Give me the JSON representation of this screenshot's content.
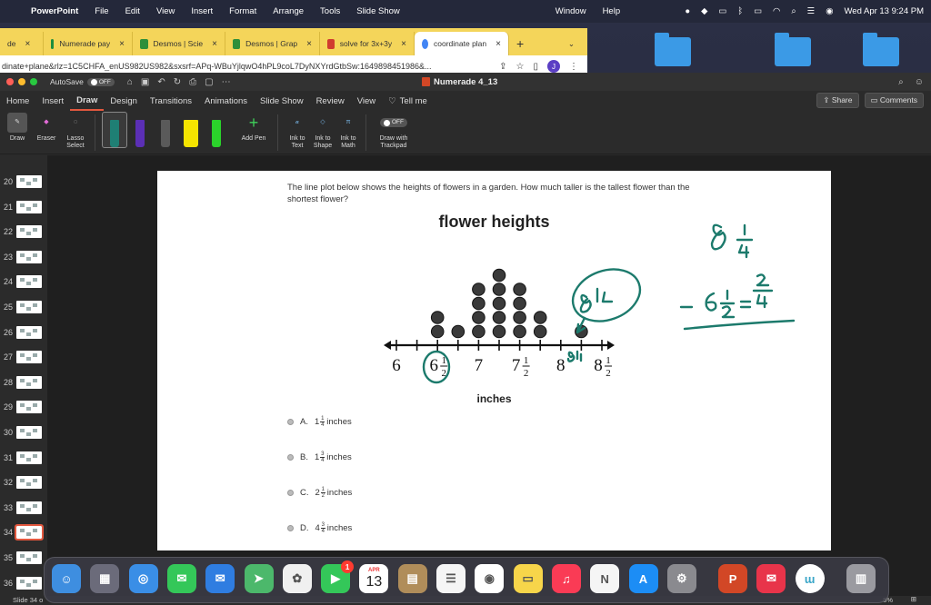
{
  "menubar": {
    "app": "PowerPoint",
    "menus": [
      "File",
      "Edit",
      "View",
      "Insert",
      "Format",
      "Arrange",
      "Tools",
      "Slide Show"
    ],
    "right_menus": [
      "Window",
      "Help"
    ],
    "clock": "Wed Apr 13  9:24 PM"
  },
  "browser": {
    "tabs": [
      {
        "label": "de",
        "color": "#f4d55a"
      },
      {
        "label": "Numerade pay",
        "color": "#1e8e3e"
      },
      {
        "label": "Desmos | Scie",
        "color": "#2f8f3a"
      },
      {
        "label": "Desmos | Grap",
        "color": "#2f8f3a"
      },
      {
        "label": "solve for 3x+3y",
        "color": "#d03c2f"
      },
      {
        "label": "coordinate plan",
        "color": "#4285f4"
      }
    ],
    "new_tab": "+",
    "url": "dinate+plane&rlz=1C5CHFA_enUS982US982&sxsrf=APq-WBuYjlqwO4hPL9coL7DyNXYrdGtbSw:1649898451986&...",
    "avatar": "J"
  },
  "ppt": {
    "autosave_label": "AutoSave",
    "autosave_state": "OFF",
    "doc_title": "Numerade 4_13",
    "ribbon_tabs": [
      "Home",
      "Insert",
      "Draw",
      "Design",
      "Transitions",
      "Animations",
      "Slide Show",
      "Review",
      "View",
      "Tell me"
    ],
    "active_tab": "Draw",
    "share_label": "Share",
    "comments_label": "Comments",
    "tools": {
      "draw": "Draw",
      "eraser": "Eraser",
      "lasso": "Lasso Select",
      "add_pen": "Add Pen",
      "ink_text": "Ink to Text",
      "ink_shape": "Ink to Shape",
      "ink_math": "Ink to Math",
      "trackpad": "Draw with Trackpad",
      "trackpad_state": "OFF"
    },
    "pens": [
      {
        "name": "pen-teal",
        "color": "#1f7f74"
      },
      {
        "name": "pen-purple",
        "color": "#5b2fb5"
      },
      {
        "name": "pen-gray",
        "color": "#5a5a5a"
      },
      {
        "name": "pen-yellow",
        "color": "#f5e400"
      },
      {
        "name": "pen-green",
        "color": "#2bd32b"
      }
    ],
    "slide_numbers": [
      "20",
      "21",
      "22",
      "23",
      "24",
      "25",
      "26",
      "27",
      "28",
      "29",
      "30",
      "31",
      "32",
      "33",
      "34",
      "35",
      "36"
    ],
    "selected_slide": "34",
    "status_slide": "Slide 34 o",
    "zoom": "5%"
  },
  "slide": {
    "question": "The line plot below shows the heights of flowers in a garden. How much taller is the tallest flower than the shortest flower?",
    "answers": [
      {
        "letter": "A.",
        "whole": "1",
        "num": "1",
        "den": "4",
        "unit": "inches"
      },
      {
        "letter": "B.",
        "whole": "1",
        "num": "3",
        "den": "4",
        "unit": "inches"
      },
      {
        "letter": "C.",
        "whole": "2",
        "num": "1",
        "den": "2",
        "unit": "inches"
      },
      {
        "letter": "D.",
        "whole": "4",
        "num": "3",
        "den": "4",
        "unit": "inches"
      }
    ],
    "handwriting": {
      "top": "8 1/4",
      "bottom": "- 6 1/2 = 2/4",
      "circle": "8 1/4",
      "small": "8 1/4",
      "color": "#1c7a6c"
    }
  },
  "chart_data": {
    "type": "scatter",
    "title": "flower heights",
    "xlabel": "inches",
    "ylabel": "",
    "tick_labels": [
      "6",
      "6 1/2",
      "7",
      "7 1/2",
      "8",
      "8 1/2"
    ],
    "ticks": [
      6,
      6.25,
      6.5,
      6.75,
      7,
      7.25,
      7.5,
      7.75,
      8,
      8.25,
      8.5
    ],
    "xlim": [
      6,
      8.5
    ],
    "x": [
      6.5,
      6.75,
      7,
      7.25,
      7.5,
      7.75,
      8.25
    ],
    "counts": [
      2,
      1,
      4,
      5,
      4,
      2,
      1
    ]
  },
  "dock": {
    "apps": [
      {
        "name": "finder",
        "color": "#3e8ee0"
      },
      {
        "name": "launchpad",
        "color": "#6b6b7a"
      },
      {
        "name": "safari",
        "color": "#3a8ee6"
      },
      {
        "name": "messages",
        "color": "#34c759"
      },
      {
        "name": "mail",
        "color": "#2f7de1"
      },
      {
        "name": "maps",
        "color": "#4cb86b"
      },
      {
        "name": "photos",
        "color": "#f0f0f0"
      },
      {
        "name": "facetime",
        "color": "#34c759"
      },
      {
        "name": "calendar",
        "color": "#ffffff"
      },
      {
        "name": "contacts",
        "color": "#b08d5a"
      },
      {
        "name": "reminders",
        "color": "#f5f5f5"
      },
      {
        "name": "chrome",
        "color": "#ffffff"
      },
      {
        "name": "notes",
        "color": "#f7d54a"
      },
      {
        "name": "music",
        "color": "#fa3b55"
      },
      {
        "name": "news",
        "color": "#f5f5f5"
      },
      {
        "name": "app-store",
        "color": "#1c8df5"
      },
      {
        "name": "system-preferences",
        "color": "#8a8a8f"
      },
      {
        "name": "powerpoint",
        "color": "#d24726"
      },
      {
        "name": "mail-alt",
        "color": "#e8344a"
      },
      {
        "name": "numerade",
        "color": "#ffffff"
      },
      {
        "name": "trash",
        "color": "#9a9aa0"
      }
    ],
    "facetime_badge": "1",
    "calendar_month": "APR",
    "calendar_day": "13"
  }
}
